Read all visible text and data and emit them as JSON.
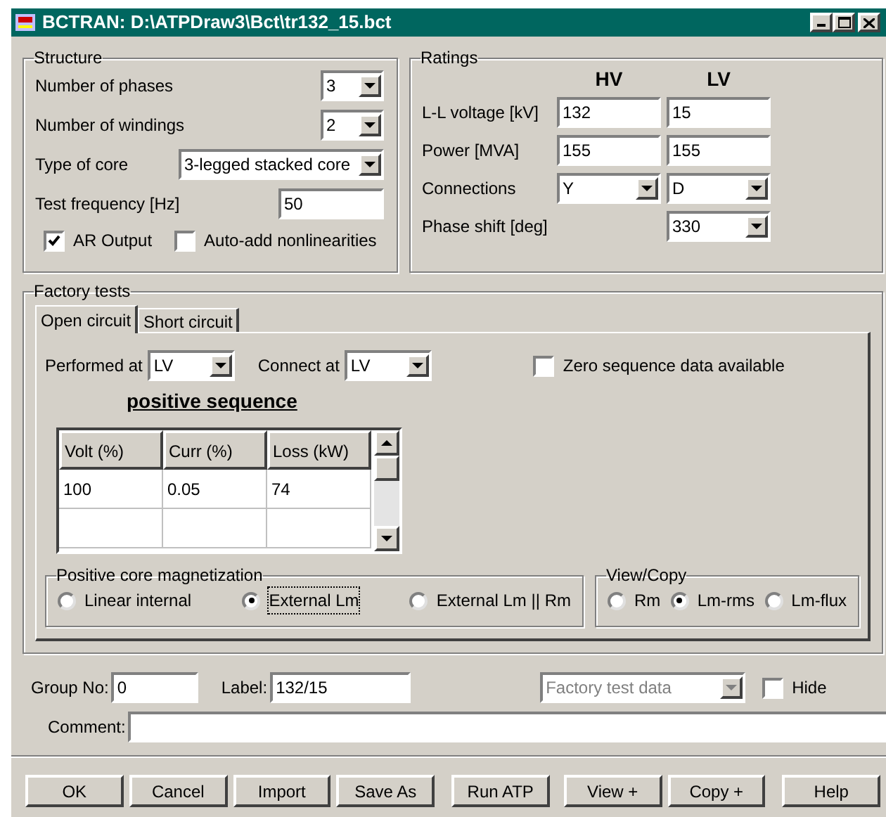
{
  "window": {
    "title": "BCTRAN: D:\\ATPDraw3\\Bct\\tr132_15.bct"
  },
  "structure": {
    "title": "Structure",
    "fields": [
      {
        "kind": "dropdown",
        "label": "Number of phases",
        "value": "3"
      },
      {
        "kind": "dropdown",
        "label": "Number of windings",
        "value": "2"
      },
      {
        "kind": "dropdown",
        "label": "Type of core",
        "value": "3-legged stacked core"
      },
      {
        "kind": "text",
        "label": "Test frequency [Hz]",
        "value": "50"
      }
    ],
    "checkboxes": [
      {
        "label": "AR Output",
        "checked": true
      },
      {
        "label": "Auto-add nonlinearities",
        "checked": false
      }
    ]
  },
  "ratings": {
    "title": "Ratings",
    "columns": [
      "HV",
      "LV"
    ],
    "rows": [
      {
        "label": "L-L voltage [kV]",
        "cells": [
          {
            "kind": "text",
            "value": "132"
          },
          {
            "kind": "text",
            "value": "15"
          }
        ]
      },
      {
        "label": "Power [MVA]",
        "cells": [
          {
            "kind": "text",
            "value": "155"
          },
          {
            "kind": "text",
            "value": "155"
          }
        ]
      },
      {
        "label": "Connections",
        "cells": [
          {
            "kind": "dropdown",
            "value": "Y"
          },
          {
            "kind": "dropdown",
            "value": "D"
          }
        ]
      },
      {
        "label": "Phase shift [deg]",
        "cells": [
          {
            "kind": "blank"
          },
          {
            "kind": "dropdown",
            "value": "330"
          }
        ]
      }
    ]
  },
  "factory_tests": {
    "title": "Factory  tests",
    "tabs": [
      {
        "label": "Open circuit",
        "selected": true
      },
      {
        "label": "Short circuit",
        "selected": false
      }
    ],
    "performed_at": {
      "label": "Performed at",
      "value": "LV"
    },
    "connect_at": {
      "label": "Connect at",
      "value": "LV"
    },
    "zero_sequence": {
      "label": "Zero sequence data available",
      "checked": false
    },
    "sequence_title": "positive sequence",
    "table": {
      "columns": [
        "Volt (%)",
        "Curr (%)",
        "Loss (kW)"
      ],
      "rows": [
        [
          "100",
          "0.05",
          "74"
        ]
      ]
    },
    "magnetization": {
      "title": "Positive core magnetization",
      "options": [
        {
          "label": "Linear internal",
          "selected": false
        },
        {
          "label": "External Lm",
          "selected": true
        },
        {
          "label": "External  Lm || Rm",
          "selected": false
        }
      ]
    },
    "view_copy": {
      "title": "View/Copy",
      "options": [
        {
          "label": "Rm",
          "selected": false
        },
        {
          "label": "Lm-rms",
          "selected": true
        },
        {
          "label": "Lm-flux",
          "selected": false
        }
      ]
    }
  },
  "group_no": {
    "label": "Group No:",
    "value": "0"
  },
  "label_field": {
    "label": "Label:",
    "value": "132/15"
  },
  "data_source": {
    "value": "Factory test data",
    "disabled": true
  },
  "hide": {
    "label": "Hide",
    "checked": false
  },
  "comment": {
    "label": "Comment:"
  },
  "buttons": [
    "OK",
    "Cancel",
    "Import",
    "Save As",
    "Run ATP",
    "View +",
    "Copy +",
    "Help"
  ]
}
